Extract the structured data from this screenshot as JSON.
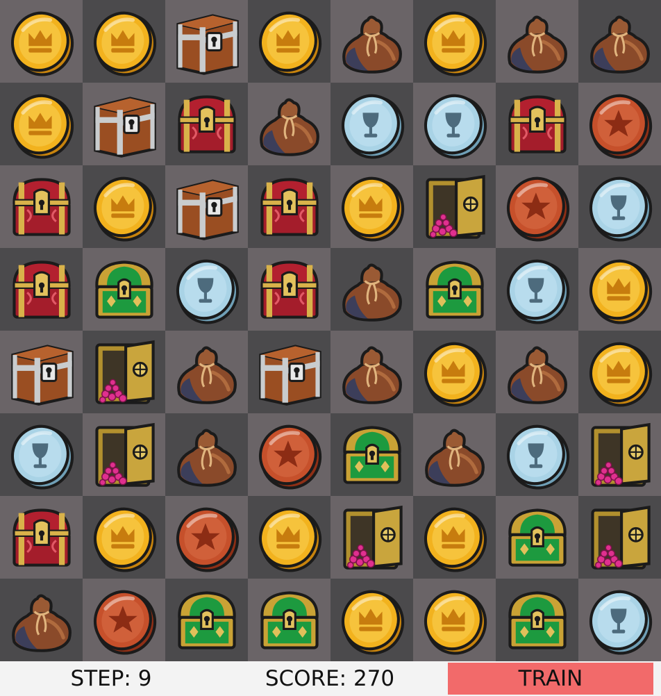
{
  "board": {
    "rows": 8,
    "cols": 8,
    "cells": [
      [
        "gold-crown-coin",
        "gold-crown-coin",
        "silver-chest",
        "gold-crown-coin",
        "loot-bag",
        "gold-crown-coin",
        "loot-bag",
        "loot-bag"
      ],
      [
        "gold-crown-coin",
        "silver-chest",
        "red-chest",
        "loot-bag",
        "silver-goblet-coin",
        "silver-goblet-coin",
        "red-chest",
        "bronze-star-coin"
      ],
      [
        "red-chest",
        "gold-crown-coin",
        "silver-chest",
        "red-chest",
        "gold-crown-coin",
        "gem-safe",
        "bronze-star-coin",
        "silver-goblet-coin"
      ],
      [
        "red-chest",
        "green-chest",
        "silver-goblet-coin",
        "red-chest",
        "loot-bag",
        "green-chest",
        "silver-goblet-coin",
        "gold-crown-coin"
      ],
      [
        "silver-chest",
        "gem-safe",
        "loot-bag",
        "silver-chest",
        "loot-bag",
        "gold-crown-coin",
        "loot-bag",
        "gold-crown-coin"
      ],
      [
        "silver-goblet-coin",
        "gem-safe",
        "loot-bag",
        "bronze-star-coin",
        "green-chest",
        "loot-bag",
        "silver-goblet-coin",
        "gem-safe"
      ],
      [
        "red-chest",
        "gold-crown-coin",
        "bronze-star-coin",
        "gold-crown-coin",
        "gem-safe",
        "gold-crown-coin",
        "green-chest",
        "gem-safe"
      ],
      [
        "loot-bag",
        "bronze-star-coin",
        "green-chest",
        "green-chest",
        "gold-crown-coin",
        "gold-crown-coin",
        "green-chest",
        "silver-goblet-coin"
      ]
    ],
    "cell_colors": {
      "light": "#6a6467",
      "dark": "#4b4a4c"
    }
  },
  "status": {
    "step_text": "STEP: 9",
    "score_text": "SCORE: 270",
    "train_label": "TRAIN",
    "train_color": "#f26a6a",
    "bar_color": "#f3f3f3"
  }
}
